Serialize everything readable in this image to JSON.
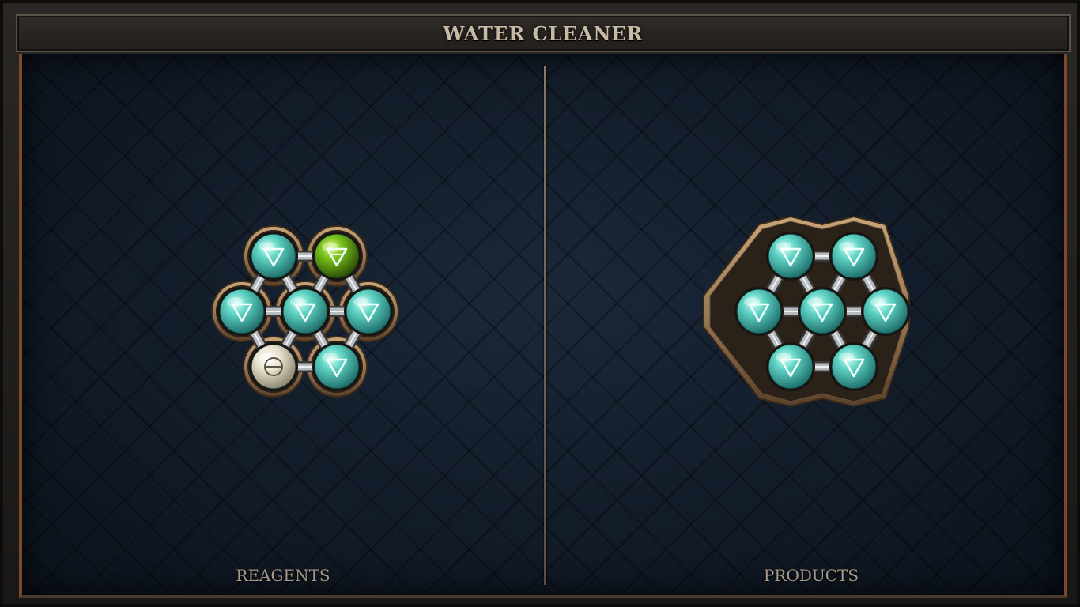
{
  "window": {
    "title": "WATER CLEANER"
  },
  "reagents": {
    "label": "REAGENTS",
    "atoms": [
      {
        "element": "water",
        "symbol": "▽"
      },
      {
        "element": "salt-tinged water",
        "symbol": "▽"
      },
      {
        "element": "water",
        "symbol": "▽"
      },
      {
        "element": "water",
        "symbol": "▽"
      },
      {
        "element": "water",
        "symbol": "▽"
      },
      {
        "element": "salt",
        "symbol": "⊖"
      },
      {
        "element": "water",
        "symbol": "▽"
      }
    ]
  },
  "products": {
    "label": "PRODUCTS",
    "atoms": [
      {
        "element": "water",
        "symbol": "▽"
      },
      {
        "element": "water",
        "symbol": "▽"
      },
      {
        "element": "water",
        "symbol": "▽"
      },
      {
        "element": "water",
        "symbol": "▽"
      },
      {
        "element": "water",
        "symbol": "▽"
      },
      {
        "element": "water",
        "symbol": "▽"
      },
      {
        "element": "water",
        "symbol": "▽"
      }
    ]
  },
  "colors": {
    "water": "#5fd4c4",
    "green": "#7ac21a",
    "salt": "#e8e2cc",
    "bronze": "#9a7a56"
  }
}
